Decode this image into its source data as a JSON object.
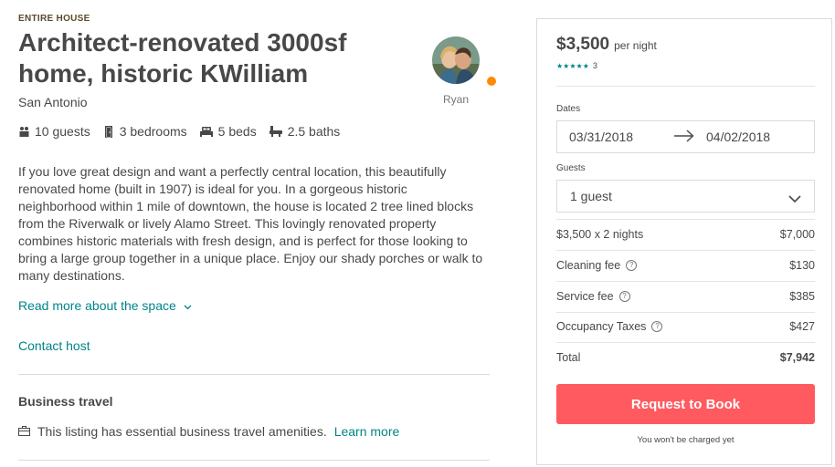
{
  "listing": {
    "room_type": "ENTIRE HOUSE",
    "title": "Architect-renovated 3000sf home, historic KWilliam",
    "city": "San Antonio",
    "host_name": "Ryan",
    "facts": [
      {
        "icon": "guests-icon",
        "label": "10 guests"
      },
      {
        "icon": "bedroom-icon",
        "label": "3 bedrooms"
      },
      {
        "icon": "bed-icon",
        "label": "5 beds"
      },
      {
        "icon": "bath-icon",
        "label": "2.5 baths"
      }
    ],
    "description": "If you love great design and want a perfectly central location, this beautifully renovated home (built in 1907) is ideal for you. In a gorgeous historic neighborhood within 1 mile of downtown, the house is located 2 tree lined blocks from the Riverwalk or lively Alamo Street. This lovingly renovated property combines historic materials with fresh design, and is perfect for those looking to bring a large group together in a unique place. Enjoy our shady porches or walk to many destinations.",
    "read_more": "Read more about the space",
    "contact_host": "Contact host",
    "business_travel_title": "Business travel",
    "business_travel_text": "This listing has essential business travel amenities.",
    "learn_more": "Learn more"
  },
  "booking": {
    "price": "$3,500",
    "per_night": "per night",
    "stars": "★★★★★",
    "review_count": "3",
    "dates_label": "Dates",
    "check_in": "03/31/2018",
    "check_out": "04/02/2018",
    "guests_label": "Guests",
    "guests_value": "1 guest",
    "lines": [
      {
        "label": "$3,500 x 2 nights",
        "amount": "$7,000",
        "info": false
      },
      {
        "label": "Cleaning fee",
        "amount": "$130",
        "info": true
      },
      {
        "label": "Service fee",
        "amount": "$385",
        "info": true
      },
      {
        "label": "Occupancy Taxes",
        "amount": "$427",
        "info": true
      }
    ],
    "total_label": "Total",
    "total_amount": "$7,942",
    "button": "Request to Book",
    "note": "You won't be charged yet"
  },
  "colors": {
    "accent": "#008489",
    "brand": "#ff5a5f",
    "text": "#484848",
    "superhost_badge": "#ff8a00"
  }
}
